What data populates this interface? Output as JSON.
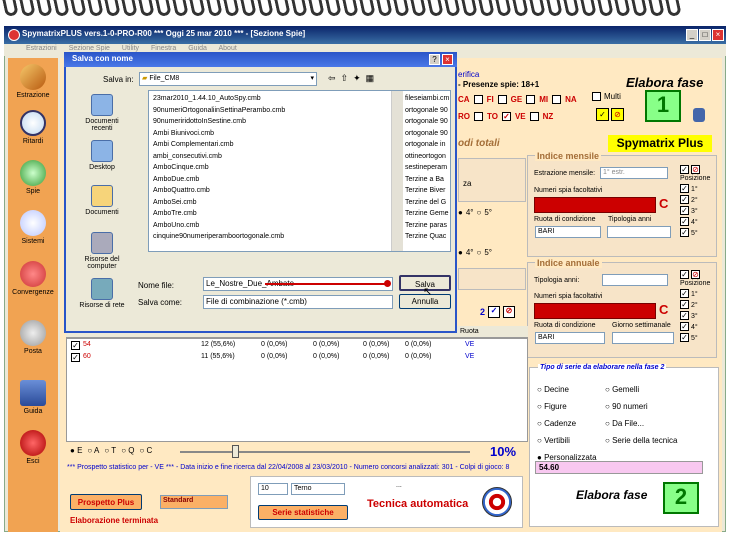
{
  "window": {
    "title": "SpymatrixPLUS vers.1-0-PRO-R00  ***  Oggi 25 mar 2010  ***  - [Sezione Spie]"
  },
  "menu": [
    "Estrazioni",
    "Sezione Spie",
    "Utility",
    "Finestra",
    "Guida",
    "About"
  ],
  "sidebar": [
    {
      "label": "Estrazione",
      "icon": "pencil-icon"
    },
    {
      "label": "Ritardi",
      "icon": "clock-icon"
    },
    {
      "label": "Spie",
      "icon": "flashlight-icon"
    },
    {
      "label": "Sistemi",
      "icon": "bulb-icon"
    },
    {
      "label": "Convergenze",
      "icon": "network-icon"
    },
    {
      "label": "Posta",
      "icon": "coin-icon"
    },
    {
      "label": "Guida",
      "icon": "book-icon"
    },
    {
      "label": "Esci",
      "icon": "exit-icon"
    }
  ],
  "main": {
    "verifica": "erifica",
    "presenze": "- Presenze spie: 18+1",
    "wheels_row1": [
      "CA",
      "FI",
      "GE",
      "MI",
      "NA"
    ],
    "wheels_row2": [
      "RO",
      "TO",
      "VE",
      "NZ"
    ],
    "multi": "Multi",
    "elabora_fase_1": "Elabora fase",
    "fase1_num": "1",
    "brand": "Spymatrix Plus",
    "modi_totali": "odi totali",
    "za": "za",
    "radio_4": "4°",
    "radio_5": "5°",
    "radio_4b": "4°",
    "radio_5b": "5°",
    "check_2": "2",
    "indice_mensile": {
      "legend": "Indice mensile",
      "estrazione_label": "Estrazione mensile:",
      "estrazione_value": "1° estr.",
      "numeri_label": "Numeri spia facoltativi",
      "c_label": "C",
      "ruota_label": "Ruota di condizione",
      "tipologia_label": "Tipologia anni",
      "ruota_value": "BARI",
      "posizione_label": "Posizione",
      "positions": [
        "1°",
        "2°",
        "3°",
        "4°",
        "5°"
      ]
    },
    "indice_annuale": {
      "legend": "Indice annuale",
      "tipologia_label": "Tipologia anni:",
      "numeri_label": "Numeri spia facoltativi",
      "c_label": "C",
      "ruota_label": "Ruota di condizione",
      "giorno_label": "Giorno settimanale",
      "ruota_value": "BARI",
      "posizione_label": "Posizione",
      "positions": [
        "1°",
        "2°",
        "3°",
        "4°",
        "5°"
      ]
    },
    "fase2": {
      "legend": "Tipo di serie da elaborare nella fase 2",
      "options_left": [
        "Decine",
        "Figure",
        "Cadenze",
        "Vertibili",
        "Personalizzata"
      ],
      "options_right": [
        "Gemelli",
        "90 numeri",
        "Da File...",
        "Serie della tecnica"
      ],
      "value": "54.60",
      "elabora": "Elabora fase",
      "num": "2"
    },
    "ruota_col": "Ruota",
    "table_rows": [
      {
        "num": "54",
        "a": "12 (55,6%)",
        "b": "0 (0,0%)",
        "c": "0 (0,0%)",
        "d": "0 (0,0%)",
        "e": "0 (0,0%)",
        "ruota": "VE"
      },
      {
        "num": "60",
        "a": "11 (55,6%)",
        "b": "0 (0,0%)",
        "c": "0 (0,0%)",
        "d": "0 (0,0%)",
        "e": "0 (0,0%)",
        "ruota": "VE"
      }
    ],
    "radio_row": [
      "E",
      "A",
      "T",
      "Q",
      "C"
    ],
    "percent": "10%",
    "status_line": "*** Prospetto statistico per  - VE ***  - Data inizio e fine ricerca dal 22/04/2008 al 23/03/2010 - Numero concorsi analizzati: 301 - Colpi di gioco: 8",
    "prospetto_btn": "Prospetto Plus",
    "standard_value": "Standard",
    "elaborazione": "Elaborazione terminata",
    "num_select": "10",
    "terno_select": "Terno",
    "serie_btn": "Serie statistiche",
    "dots": "...",
    "tecnica": "Tecnica automatica"
  },
  "dialog": {
    "title": "Salva con nome",
    "salva_in_label": "Salva in:",
    "folder": "File_CM8",
    "places": [
      "Documenti recenti",
      "Desktop",
      "Documenti",
      "Risorse del computer",
      "Risorse di rete"
    ],
    "files_col1": [
      "23mar2010_1.44.10_AutoSpy.cmb",
      "90numeriOrtogonaliinSettinaPerambo.cmb",
      "90numeriridottoInSestine.cmb",
      "Ambi Biunivoci.cmb",
      "Ambi Complementari.cmb",
      "ambi_consecutivi.cmb",
      "AmboCinque.cmb",
      "AmboDue.cmb",
      "AmboQuattro.cmb",
      "AmboSei.cmb",
      "AmboTre.cmb",
      "AmboUno.cmb",
      "cinquine90numeriperamboortogonale.cmb"
    ],
    "files_col2": [
      "fileseiambi.cm",
      "ortogonale 90",
      "ortogonale 90",
      "ortogonale 90",
      "ortogonale in",
      "ottineortogon",
      "sestineperam",
      "Terzine a Ba",
      "Terzine Biver",
      "Terzine del G",
      "Terzine Geme",
      "Terzine paras",
      "Terzine Quac"
    ],
    "nome_file_label": "Nome file:",
    "nome_file_value": "Le_Nostre_Due_Ambate",
    "salva_come_label": "Salva come:",
    "salva_come_value": "File di combinazione (*.cmb)",
    "salva_btn": "Salva",
    "annulla_btn": "Annulla"
  }
}
